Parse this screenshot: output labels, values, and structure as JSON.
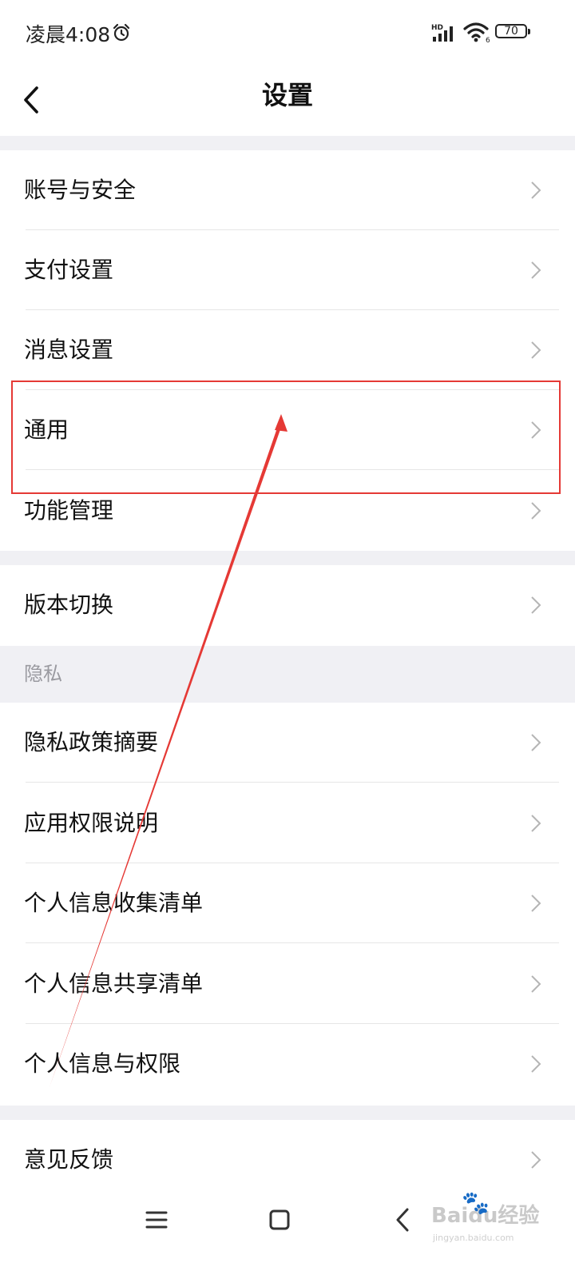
{
  "status_bar": {
    "time": "凌晨4:08",
    "battery": "70",
    "network": "HD",
    "wifi_badge": "6"
  },
  "header": {
    "title": "设置"
  },
  "groups": {
    "g1": [
      {
        "label": "账号与安全"
      },
      {
        "label": "支付设置"
      },
      {
        "label": "消息设置"
      },
      {
        "label": "通用"
      },
      {
        "label": "功能管理"
      }
    ],
    "g2": [
      {
        "label": "版本切换"
      }
    ],
    "privacy_header": "隐私",
    "g3": [
      {
        "label": "隐私政策摘要"
      },
      {
        "label": "应用权限说明"
      },
      {
        "label": "个人信息收集清单"
      },
      {
        "label": "个人信息共享清单"
      },
      {
        "label": "个人信息与权限"
      }
    ],
    "g4": [
      {
        "label": "意见反馈"
      }
    ]
  },
  "watermark": {
    "brand": "Baidu经验",
    "url": "jingyan.baidu.com"
  },
  "colors": {
    "annotation": "#e53935",
    "gap": "#f0f0f4",
    "divider": "#e6e6e6",
    "section_text": "#9a9aa0"
  }
}
